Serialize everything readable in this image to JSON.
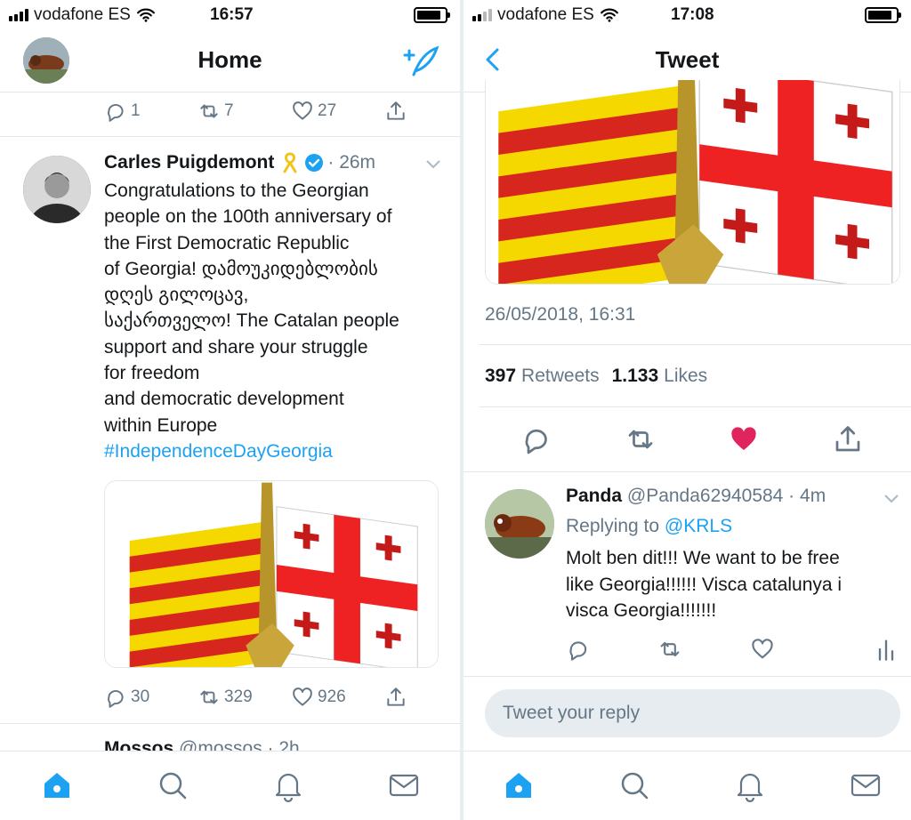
{
  "left": {
    "status": {
      "carrier": "vodafone ES",
      "time": "16:57"
    },
    "header": {
      "title": "Home"
    },
    "prev_tweet_actions": {
      "replies": "1",
      "retweets": "7",
      "likes": "27"
    },
    "tweet": {
      "name": "Carles Puigdemont",
      "time": "· 26m",
      "lines": [
        "Congratulations to the Georgian",
        "people on the 100th anniversary of",
        "the First Democratic Republic",
        "of Georgia! დამოუკიდებლობის",
        "დღეს გილოცავ,",
        "საქართველო! The Catalan people",
        "support and share your struggle",
        "for freedom",
        "and democratic development",
        "within Europe"
      ],
      "hashtag": "#IndependenceDayGeorgia",
      "actions": {
        "replies": "30",
        "retweets": "329",
        "likes": "926"
      }
    },
    "next_tweet_partial": {
      "name": "Mossos",
      "handle": "@mossos · 2h"
    }
  },
  "right": {
    "status": {
      "carrier": "vodafone ES",
      "time": "17:08"
    },
    "header": {
      "title": "Tweet"
    },
    "tweet_date": "26/05/2018, 16:31",
    "stats": {
      "retweets_count": "397",
      "retweets_label": "Retweets",
      "likes_count": "1.133",
      "likes_label": "Likes"
    },
    "reply": {
      "name": "Panda",
      "handle": "@Panda62940584 · 4m",
      "replying_prefix": "Replying to",
      "replying_to": "@KRLS",
      "lines": [
        "Molt ben dit!!! We want to be free",
        "like Georgia!!!!!! Visca catalunya i",
        "visca Georgia!!!!!!!"
      ]
    },
    "reply_placeholder": "Tweet your reply"
  },
  "colors": {
    "brand": "#1da1f2",
    "liked": "#e0245e",
    "muted": "#657786",
    "text": "#14171a"
  },
  "icons": [
    "home-icon",
    "search-icon",
    "bell-icon",
    "mail-icon",
    "reply-icon",
    "retweet-icon",
    "heart-icon",
    "share-icon",
    "compose-icon",
    "back-icon",
    "verified-icon",
    "ribbon-icon",
    "analytics-icon"
  ]
}
